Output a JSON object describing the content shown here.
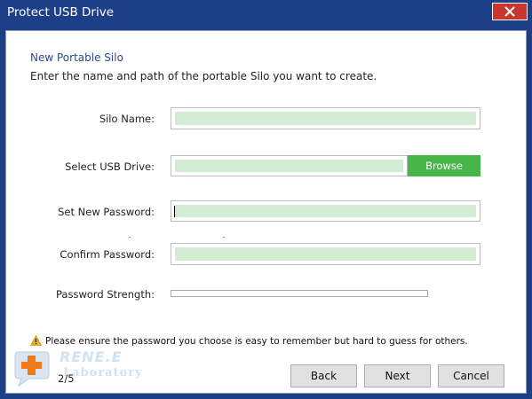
{
  "window": {
    "title": "Protect USB Drive",
    "close_icon": "close-icon"
  },
  "section": {
    "title": "New Portable Silo",
    "description": "Enter the name and path of the portable Silo you want to create."
  },
  "form": {
    "silo_name": {
      "label": "Silo Name:",
      "value": ""
    },
    "usb_drive": {
      "label": "Select USB Drive:",
      "value": "",
      "browse_label": "Browse"
    },
    "new_password": {
      "label": "Set New Password:",
      "value": ""
    },
    "confirm_password": {
      "label": "Confirm Password:",
      "value": ""
    },
    "password_strength": {
      "label": "Password Strength:",
      "level": 0
    }
  },
  "warning": {
    "icon": "warning-icon",
    "text": "Please ensure the password you choose is easy to remember but hard to guess for others."
  },
  "logo": {
    "line1": "RENE.E",
    "line2": "Laboratory",
    "icon": "first-aid-plus-icon"
  },
  "footer": {
    "page_indicator": "2/5",
    "back_label": "Back",
    "next_label": "Next",
    "cancel_label": "Cancel"
  },
  "colors": {
    "titlebar": "#1d3f87",
    "close_button": "#c7372e",
    "field_fill": "#d3ecd4",
    "browse_button": "#46b649",
    "section_title": "#2d4a8c"
  }
}
